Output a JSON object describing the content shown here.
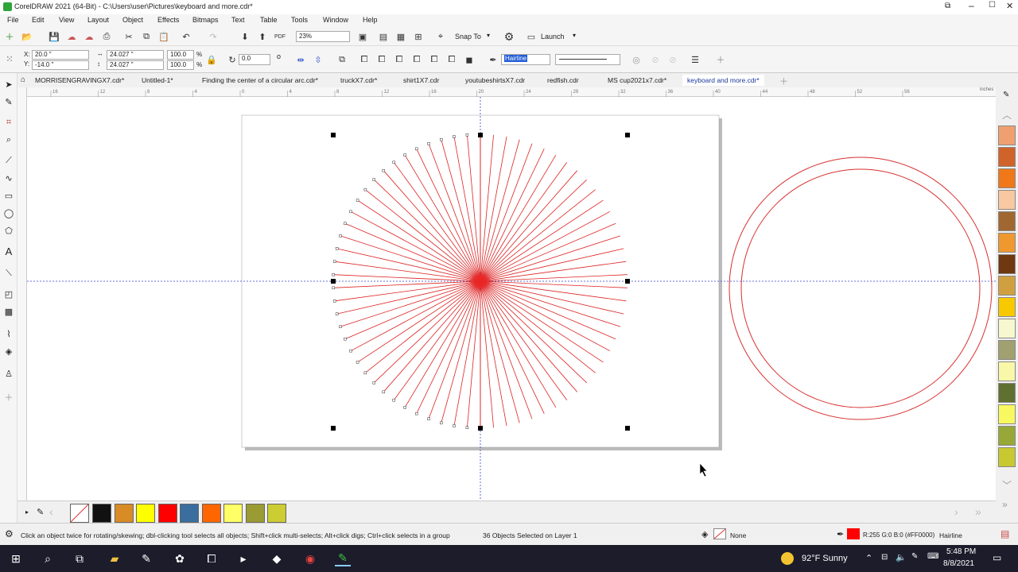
{
  "window": {
    "title": "CorelDRAW 2021 (64-Bit) - C:\\Users\\user\\Pictures\\keyboard and more.cdr*"
  },
  "menu": [
    "File",
    "Edit",
    "View",
    "Layout",
    "Object",
    "Effects",
    "Bitmaps",
    "Text",
    "Table",
    "Tools",
    "Window",
    "Help"
  ],
  "toolbar": {
    "zoom": "23%",
    "snap_to": "Snap To",
    "launch": "Launch"
  },
  "property_bar": {
    "x": "20.0 \"",
    "y": "-14.0 \"",
    "width": "24.027 \"",
    "height": "24.027 \"",
    "scale_w": "100.0",
    "scale_h": "100.0",
    "percent": "%",
    "rotation": "0.0",
    "degree": "o",
    "outline_width": "Hairline"
  },
  "tabs": [
    "MORRISENGRAVINGX7.cdr*",
    "Untitled-1*",
    "Finding the center of a circular arc.cdr*",
    "truckX7.cdr*",
    "shirt1X7.cdr",
    "youtubeshirtsX7.cdr",
    "redfish.cdr",
    "MS cup2021x7.cdr*",
    "keyboard and more.cdr*"
  ],
  "ruler": {
    "unit": "inches",
    "ticks": [
      "16",
      "12",
      "8",
      "4",
      "0",
      "4",
      "8",
      "12",
      "16",
      "20",
      "24",
      "28",
      "32",
      "36",
      "40",
      "44",
      "48",
      "52",
      "56"
    ]
  },
  "colors": {
    "accent": "#3355cc",
    "line_red": "#dd2222",
    "selection_blue": "#1e5bd6"
  },
  "right_palette": [
    "#f0a070",
    "#d0632a",
    "#f07818",
    "#f8c8a0",
    "#a06830",
    "#f09830",
    "#703810",
    "#d0a040",
    "#f8c800",
    "#f8f8d0",
    "#a0a070",
    "#f8f8a8",
    "#607030",
    "#f8f860",
    "#98a838",
    "#c8c830"
  ],
  "bottom_palette": [
    "#111111",
    "#d98b25",
    "#ffff00",
    "#ff0000",
    "#3a6e9e",
    "#ff6600",
    "#ffff66",
    "#9b9b33",
    "#cccc33"
  ],
  "status": {
    "hint": "Click an object twice for rotating/skewing; dbl-clicking tool selects all objects; Shift+click multi-selects; Alt+click digs; Ctrl+click selects in a group",
    "selection": "36 Objects Selected on Layer 1",
    "fill": "None",
    "outline_color": "R:255 G:0 B:0 (#FF0000)",
    "outline_width": "Hairline"
  },
  "taskbar": {
    "weather": "92°F  Sunny",
    "time": "5:48 PM",
    "date": "8/8/2021"
  }
}
